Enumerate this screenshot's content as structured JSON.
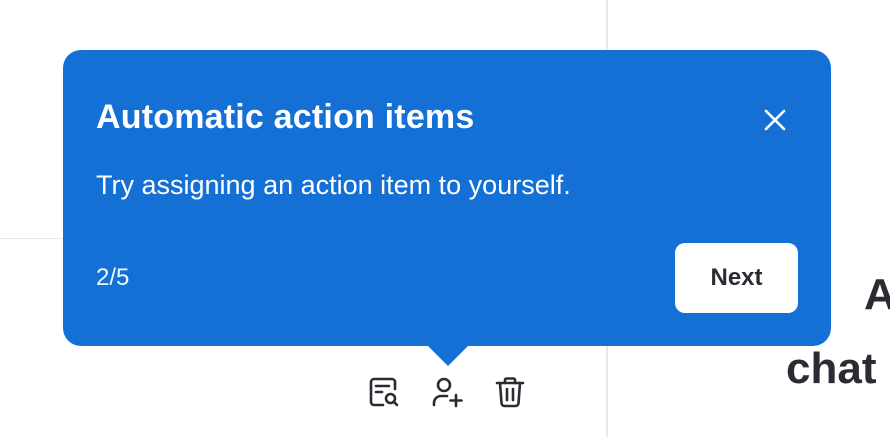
{
  "tooltip": {
    "title": "Automatic action items",
    "body": "Try assigning an action item to yourself.",
    "step": "2/5",
    "next_label": "Next",
    "background_color": "#1570d6"
  },
  "background": {
    "right_heading": "A",
    "right_subtext": "chat"
  },
  "action_icons": [
    {
      "icon": "find-in-document-icon"
    },
    {
      "icon": "assign-user-icon"
    },
    {
      "icon": "trash-icon"
    }
  ]
}
